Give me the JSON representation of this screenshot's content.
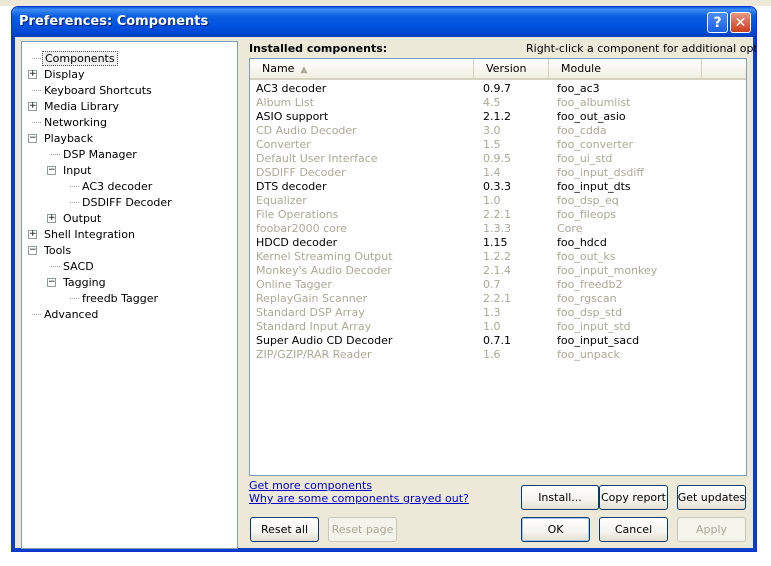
{
  "window": {
    "title": "Preferences: Components"
  },
  "title_buttons": {
    "help": "?",
    "close": "✕"
  },
  "tree": [
    {
      "label": "Components",
      "expander": "",
      "selected": true
    },
    {
      "label": "Display",
      "expander": "+"
    },
    {
      "label": "Keyboard Shortcuts",
      "expander": ""
    },
    {
      "label": "Media Library",
      "expander": "+"
    },
    {
      "label": "Networking",
      "expander": ""
    },
    {
      "label": "Playback",
      "expander": "−"
    },
    {
      "label": "DSP Manager",
      "expander": ""
    },
    {
      "label": "Input",
      "expander": "−"
    },
    {
      "label": "AC3 decoder",
      "expander": ""
    },
    {
      "label": "DSDIFF Decoder",
      "expander": ""
    },
    {
      "label": "Output",
      "expander": "+"
    },
    {
      "label": "Shell Integration",
      "expander": "+"
    },
    {
      "label": "Tools",
      "expander": "−"
    },
    {
      "label": "SACD",
      "expander": ""
    },
    {
      "label": "Tagging",
      "expander": "−"
    },
    {
      "label": "freedb Tagger",
      "expander": ""
    },
    {
      "label": "Advanced",
      "expander": ""
    }
  ],
  "components": {
    "header": "Installed components:",
    "hint": "Right-click a component for additional options.",
    "columns": {
      "name": "Name",
      "version": "Version",
      "module": "Module",
      "sort_indicator": "▲"
    },
    "rows": [
      {
        "name": "AC3 decoder",
        "version": "0.9.7",
        "module": "foo_ac3",
        "grayed": false
      },
      {
        "name": "Album List",
        "version": "4.5",
        "module": "foo_albumlist",
        "grayed": true
      },
      {
        "name": "ASIO support",
        "version": "2.1.2",
        "module": "foo_out_asio",
        "grayed": false
      },
      {
        "name": "CD Audio Decoder",
        "version": "3.0",
        "module": "foo_cdda",
        "grayed": true
      },
      {
        "name": "Converter",
        "version": "1.5",
        "module": "foo_converter",
        "grayed": true
      },
      {
        "name": "Default User Interface",
        "version": "0.9.5",
        "module": "foo_ui_std",
        "grayed": true
      },
      {
        "name": "DSDIFF Decoder",
        "version": "1.4",
        "module": "foo_input_dsdiff",
        "grayed": true
      },
      {
        "name": "DTS decoder",
        "version": "0.3.3",
        "module": "foo_input_dts",
        "grayed": false
      },
      {
        "name": "Equalizer",
        "version": "1.0",
        "module": "foo_dsp_eq",
        "grayed": true
      },
      {
        "name": "File Operations",
        "version": "2.2.1",
        "module": "foo_fileops",
        "grayed": true
      },
      {
        "name": "foobar2000 core",
        "version": "1.3.3",
        "module": "Core",
        "grayed": true
      },
      {
        "name": "HDCD decoder",
        "version": "1.15",
        "module": "foo_hdcd",
        "grayed": false
      },
      {
        "name": "Kernel Streaming Output",
        "version": "1.2.2",
        "module": "foo_out_ks",
        "grayed": true
      },
      {
        "name": "Monkey's Audio Decoder",
        "version": "2.1.4",
        "module": "foo_input_monkey",
        "grayed": true
      },
      {
        "name": "Online Tagger",
        "version": "0.7",
        "module": "foo_freedb2",
        "grayed": true
      },
      {
        "name": "ReplayGain Scanner",
        "version": "2.2.1",
        "module": "foo_rgscan",
        "grayed": true
      },
      {
        "name": "Standard DSP Array",
        "version": "1.3",
        "module": "foo_dsp_std",
        "grayed": true
      },
      {
        "name": "Standard Input Array",
        "version": "1.0",
        "module": "foo_input_std",
        "grayed": true
      },
      {
        "name": "Super Audio CD Decoder",
        "version": "0.7.1",
        "module": "foo_input_sacd",
        "grayed": false
      },
      {
        "name": "ZIP/GZIP/RAR Reader",
        "version": "1.6",
        "module": "foo_unpack",
        "grayed": true
      }
    ]
  },
  "links": {
    "get_more": "Get more components",
    "why_grayed": "Why are some components grayed out?"
  },
  "buttons": {
    "install": "Install...",
    "copy_report": "Copy report",
    "get_updates": "Get updates",
    "reset_all": "Reset all",
    "reset_page": "Reset page",
    "ok": "OK",
    "cancel": "Cancel",
    "apply": "Apply"
  },
  "colors": {
    "titlebar": "#0053E1",
    "window_face": "#ECE9D8",
    "grayed_text": "#ACA899",
    "link": "#0000CC"
  }
}
